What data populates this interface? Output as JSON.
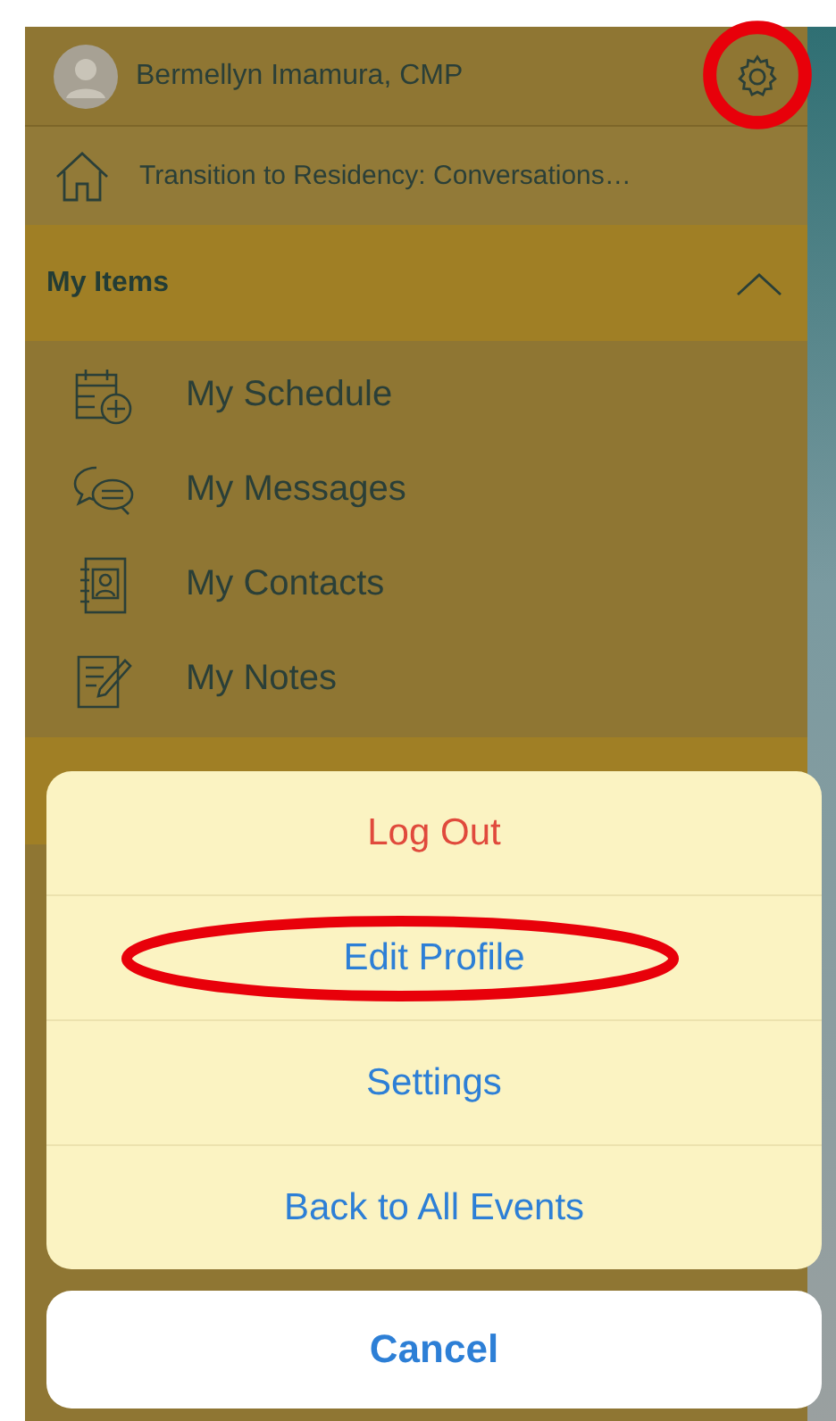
{
  "header": {
    "user_name": "Bermellyn Imamura, CMP",
    "settings_annotated": true
  },
  "event": {
    "title": "Transition to Residency: Conversations…"
  },
  "section": {
    "title": "My Items",
    "expanded": true
  },
  "items": [
    {
      "label": "My Schedule",
      "kind": "schedule"
    },
    {
      "label": "My Messages",
      "kind": "messages"
    },
    {
      "label": "My Contacts",
      "kind": "contacts"
    },
    {
      "label": "My Notes",
      "kind": "notes"
    }
  ],
  "action_sheet": {
    "actions": [
      {
        "label": "Log Out",
        "kind": "destructive",
        "annotated": false
      },
      {
        "label": "Edit Profile",
        "kind": "default",
        "annotated": true
      },
      {
        "label": "Settings",
        "kind": "default",
        "annotated": false
      },
      {
        "label": "Back to All Events",
        "kind": "default",
        "annotated": false
      }
    ],
    "cancel": "Cancel"
  }
}
